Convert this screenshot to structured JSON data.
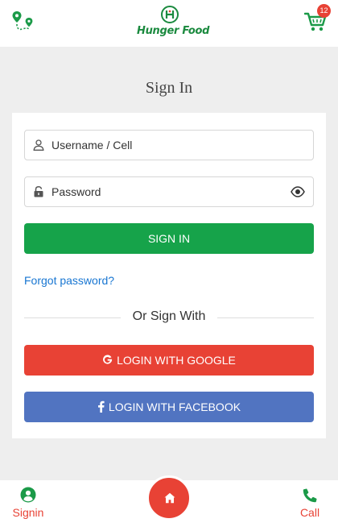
{
  "header": {
    "brand_name": "Hunger Food",
    "cart_count": "12",
    "icons": {
      "location": "map-route-icon",
      "cart": "cart-icon",
      "logo": "hunger-food-logo"
    }
  },
  "page": {
    "title": "Sign In"
  },
  "form": {
    "username": {
      "placeholder": "Username / Cell",
      "value": "",
      "icon": "user-icon"
    },
    "password": {
      "placeholder": "Password",
      "value": "",
      "icon": "lock-icon",
      "toggle_icon": "eye-icon"
    },
    "signin_label": "SIGN IN",
    "forgot_label": "Forgot password?"
  },
  "social": {
    "divider_label": "Or Sign With",
    "google_label": "LOGIN WITH GOOGLE",
    "facebook_label": "LOGIN WITH FACEBOOK",
    "icons": {
      "google": "google-icon",
      "facebook": "facebook-icon"
    }
  },
  "bottom_nav": {
    "signin_label": "Signin",
    "call_label": "Call",
    "icons": {
      "signin": "user-circle-icon",
      "home": "home-icon",
      "call": "phone-icon"
    }
  },
  "colors": {
    "primary_green": "#16a34a",
    "brand_green": "#1b8a3f",
    "accent_red": "#e84235",
    "facebook_blue": "#5174c1",
    "link_blue": "#1876d2",
    "background": "#eeeeee"
  }
}
